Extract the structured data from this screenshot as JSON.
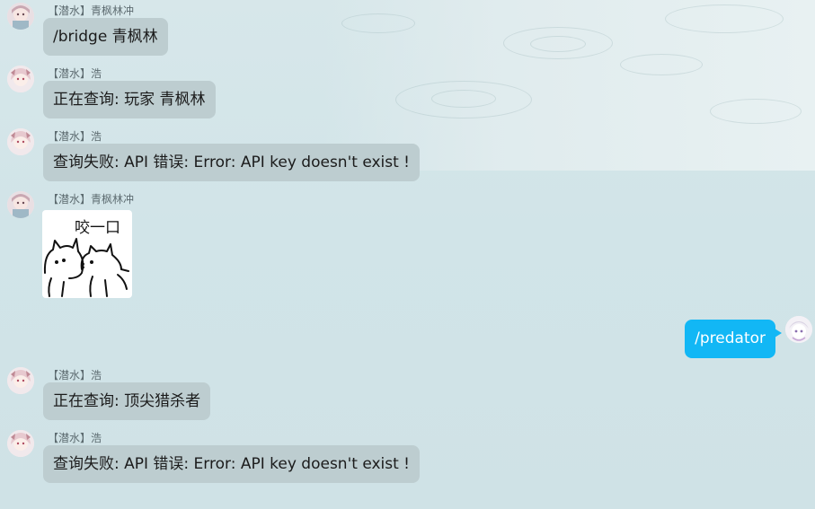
{
  "messages": [
    {
      "nick": "【潜水】青枫林冲",
      "text": "/bridge 青枫林"
    },
    {
      "nick": "【潜水】浩",
      "text": "正在查询: 玩家 青枫林"
    },
    {
      "nick": "【潜水】浩",
      "text": "查询失败: API 错误: Error: API key doesn't exist !"
    },
    {
      "nick": "【潜水】青枫林冲",
      "sticker_caption": "咬一口"
    },
    {
      "self": true,
      "text": "/predator"
    },
    {
      "nick": "【潜水】浩",
      "text": "正在查询: 顶尖猎杀者"
    },
    {
      "nick": "【潜水】浩",
      "text": "查询失败: API 错误: Error: API key doesn't exist !"
    }
  ],
  "colors": {
    "incoming_bubble": "#bdcdd0",
    "outgoing_bubble": "#12b7f5",
    "background": "#d1e4e8"
  }
}
